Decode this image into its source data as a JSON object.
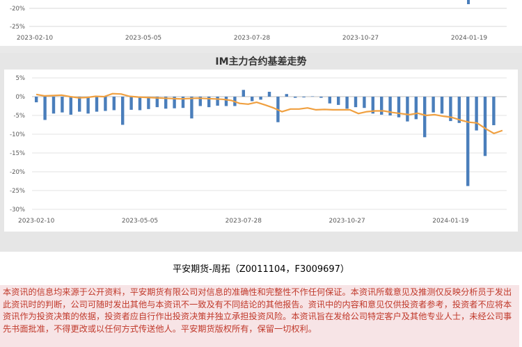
{
  "top_chart": {
    "ytick_labels": [
      "-20%",
      "-25%"
    ],
    "xtick_labels": [
      "2023-02-10",
      "2023-05-05",
      "2023-07-28",
      "2023-10-27",
      "2024-01-19"
    ]
  },
  "chart_data": {
    "type": "bar",
    "title": "IM主力合约基差走势",
    "ylim": [
      -0.3,
      0.05
    ],
    "ytick_labels": [
      "5%",
      "0%",
      "-5%",
      "-10%",
      "-15%",
      "-20%",
      "-25%",
      "-30%"
    ],
    "ytick_values": [
      0.05,
      0,
      -0.05,
      -0.1,
      -0.15,
      -0.2,
      -0.25,
      -0.3
    ],
    "xtick_labels": [
      "2023-02-10",
      "2023-05-05",
      "2023-07-28",
      "2023-10-27",
      "2024-01-19"
    ],
    "xtick_index": [
      0,
      12,
      24,
      36,
      48
    ],
    "grid": true,
    "series": [
      {
        "kind": "bar",
        "color": "#4a7ebb",
        "values": [
          -0.015,
          -0.062,
          -0.045,
          -0.042,
          -0.048,
          -0.04,
          -0.045,
          -0.04,
          -0.038,
          -0.036,
          -0.075,
          -0.035,
          -0.036,
          -0.033,
          -0.028,
          -0.032,
          -0.031,
          -0.03,
          -0.058,
          -0.025,
          -0.028,
          -0.024,
          -0.025,
          -0.025,
          0.018,
          -0.012,
          -0.008,
          0.013,
          -0.068,
          0.007,
          -0.003,
          -0.002,
          0.001,
          -0.003,
          -0.018,
          -0.022,
          -0.032,
          -0.028,
          -0.03,
          -0.045,
          -0.048,
          -0.05,
          -0.055,
          -0.066,
          -0.06,
          -0.108,
          -0.042,
          -0.045,
          -0.065,
          -0.07,
          -0.238,
          -0.09,
          -0.158,
          -0.076
        ]
      },
      {
        "kind": "line",
        "color": "#f0a040",
        "values": [
          0.006,
          0.002,
          0.003,
          0.004,
          0.0,
          -0.003,
          -0.002,
          0.001,
          0.0,
          0.008,
          0.007,
          0.001,
          -0.001,
          -0.002,
          -0.003,
          -0.004,
          -0.005,
          -0.006,
          -0.005,
          -0.004,
          -0.005,
          -0.006,
          -0.007,
          -0.01,
          -0.018,
          -0.02,
          -0.015,
          -0.022,
          -0.03,
          -0.04,
          -0.033,
          -0.033,
          -0.03,
          -0.035,
          -0.034,
          -0.035,
          -0.035,
          -0.035,
          -0.045,
          -0.04,
          -0.038,
          -0.038,
          -0.042,
          -0.045,
          -0.048,
          -0.044,
          -0.05,
          -0.048,
          -0.052,
          -0.055,
          -0.062,
          -0.068,
          -0.07,
          -0.085,
          -0.098,
          -0.09
        ]
      }
    ]
  },
  "signature": "平安期货-周拓（Z0011104，F3009697）",
  "disclaimer": "本资讯的信息均来源于公开资料，平安期货有限公司对信息的准确性和完整性不作任何保证。本资讯所载意见及推测仅反映分析员于发出此资讯时的判断，公司可随时发出其他与本资讯不一致及有不同结论的其他报告。资讯中的内容和意见仅供投资者参考，投资者不应将本资讯作为投资决策的依据，投资者应自行作出投资决策并独立承担投资风险。本资讯旨在发给公司特定客户及其他专业人士，未经公司事先书面批准，不得更改或以任何方式传送他人。平安期货版权所有，保留一切权利。"
}
